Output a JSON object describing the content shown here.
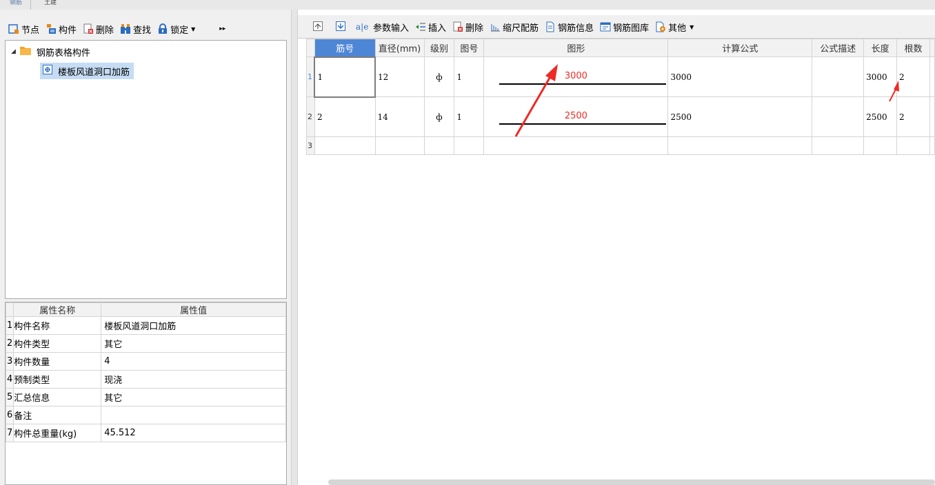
{
  "top_tabs": [
    "钢筋",
    "土建"
  ],
  "left_toolbar": {
    "node_label": "节点",
    "component_label": "构件",
    "delete_label": "删除",
    "find_label": "查找",
    "lock_label": "锁定",
    "more_glyph": "▸▸"
  },
  "tree": {
    "root_label": "钢筋表格构件",
    "child_label": "楼板风道洞口加筋"
  },
  "properties": {
    "headers": [
      "属性名称",
      "属性值"
    ],
    "rows": [
      {
        "num": "1",
        "name": "构件名称",
        "value": "楼板风道洞口加筋"
      },
      {
        "num": "2",
        "name": "构件类型",
        "value": "其它"
      },
      {
        "num": "3",
        "name": "构件数量",
        "value": "4"
      },
      {
        "num": "4",
        "name": "预制类型",
        "value": "现浇"
      },
      {
        "num": "5",
        "name": "汇总信息",
        "value": "其它"
      },
      {
        "num": "6",
        "name": "备注",
        "value": ""
      },
      {
        "num": "7",
        "name": "构件总重量(kg)",
        "value": "45.512"
      }
    ]
  },
  "right_toolbar": {
    "param_input_label": "参数输入",
    "insert_label": "插入",
    "delete_label": "删除",
    "scale_rebar_label": "缩尺配筋",
    "rebar_info_label": "钢筋信息",
    "rebar_library_label": "钢筋图库",
    "other_label": "其他"
  },
  "grid": {
    "headers": [
      "筋号",
      "直径(mm)",
      "级别",
      "图号",
      "图形",
      "计算公式",
      "公式描述",
      "长度",
      "根数"
    ],
    "rows": [
      {
        "num": "1",
        "bar_no": "1",
        "diameter": "12",
        "grade": "ф",
        "shape_no": "1",
        "shape_value": "3000",
        "formula": "3000",
        "desc": "",
        "length": "3000",
        "count": "2"
      },
      {
        "num": "2",
        "bar_no": "2",
        "diameter": "14",
        "grade": "ф",
        "shape_no": "1",
        "shape_value": "2500",
        "formula": "2500",
        "desc": "",
        "length": "2500",
        "count": "2"
      }
    ],
    "empty_row_num": "3"
  },
  "colors": {
    "accent_red": "#ee2a24",
    "header_blue": "#4e86d6",
    "tree_selected": "#c5dcf3"
  }
}
